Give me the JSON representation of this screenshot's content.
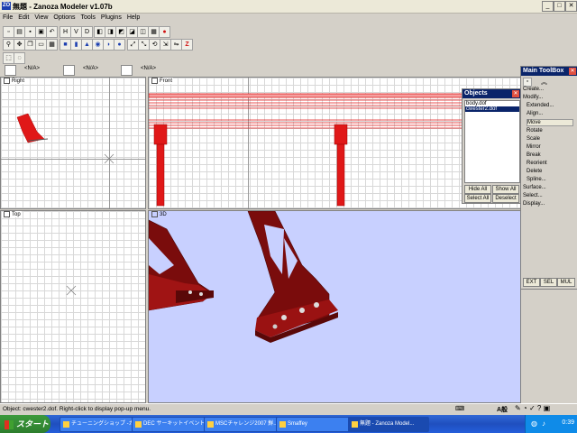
{
  "window": {
    "title": "無題 - Zanoza Modeler v1.07b",
    "logo": "ZO",
    "controls": {
      "minimize": "_",
      "maximize": "□",
      "close": "✕"
    }
  },
  "menu": [
    "File",
    "Edit",
    "View",
    "Options",
    "Tools",
    "Plugins",
    "Help"
  ],
  "toolbar": {
    "row1": [
      "new-icon",
      "open-icon",
      "save-icon",
      "saveas-icon",
      "print-icon",
      "undo-icon",
      "H",
      "V",
      "D",
      "cube-view-icon",
      "cube-solid-icon",
      "cube-wire-icon",
      "cube-alt-icon",
      "cube-alt2-icon",
      "cube-alt3-icon",
      "sphere-icon"
    ],
    "row2": [
      "zoom-icon",
      "pan-icon",
      "copy-icon",
      "paste-icon",
      "grid-icon",
      "image-icon",
      "cube-icon",
      "cylinder-icon",
      "cone-icon",
      "torus-icon",
      "sphere-icon",
      "hemisphere-icon",
      "move-x-icon",
      "move-y-icon",
      "rotate-icon",
      "scale-icon",
      "mirror-icon",
      "z-icon"
    ],
    "row3": [
      "select-rect-icon",
      "select-circle-icon"
    ]
  },
  "viewport_selectors": [
    "<N/A>",
    "<N/A>",
    "<N/A>"
  ],
  "viewports": {
    "right": "Right",
    "front": "Front",
    "top": "Top",
    "persp": "3D"
  },
  "objects_panel": {
    "title": "Objects",
    "items": [
      "body.dof",
      "cwester2.dof"
    ],
    "selected_index": 1,
    "buttons": {
      "hide_all": "Hide All",
      "show_all": "Show All",
      "select_all": "Select All",
      "deselect": "Deselect"
    }
  },
  "toolbox": {
    "title": "Main ToolBox",
    "items": [
      "Create...",
      "Modify...",
      "Extended...",
      "Align...",
      "Move",
      "Rotate",
      "Scale",
      "Mirror",
      "Break",
      "Reorient",
      "Delete",
      "Spline...",
      "Surface...",
      "Select...",
      "Display..."
    ],
    "active_index": 4,
    "tabs": [
      "EXT",
      "SEL",
      "MUL"
    ]
  },
  "status": {
    "text": "Object: cwester2.dof. Right-click to display pop-up menu.",
    "ime": "A般"
  },
  "taskbar": {
    "start": "スタート",
    "tasks": [
      "チューニングショップ -カ...",
      "DEC サーキットイベント...",
      "MSCチャレンジ2007 鮮...",
      "Smaffey",
      "無題 - Zanoza Model..."
    ],
    "active_index": 4,
    "clock": "0:39"
  },
  "colors": {
    "titlebar": "#ece9d8",
    "model_red": "#e01818",
    "model_dark": "#8a1010",
    "viewport_3d_bg": "#c8d0ff",
    "taskbar": "#245edb",
    "selection": "#0a246a"
  }
}
